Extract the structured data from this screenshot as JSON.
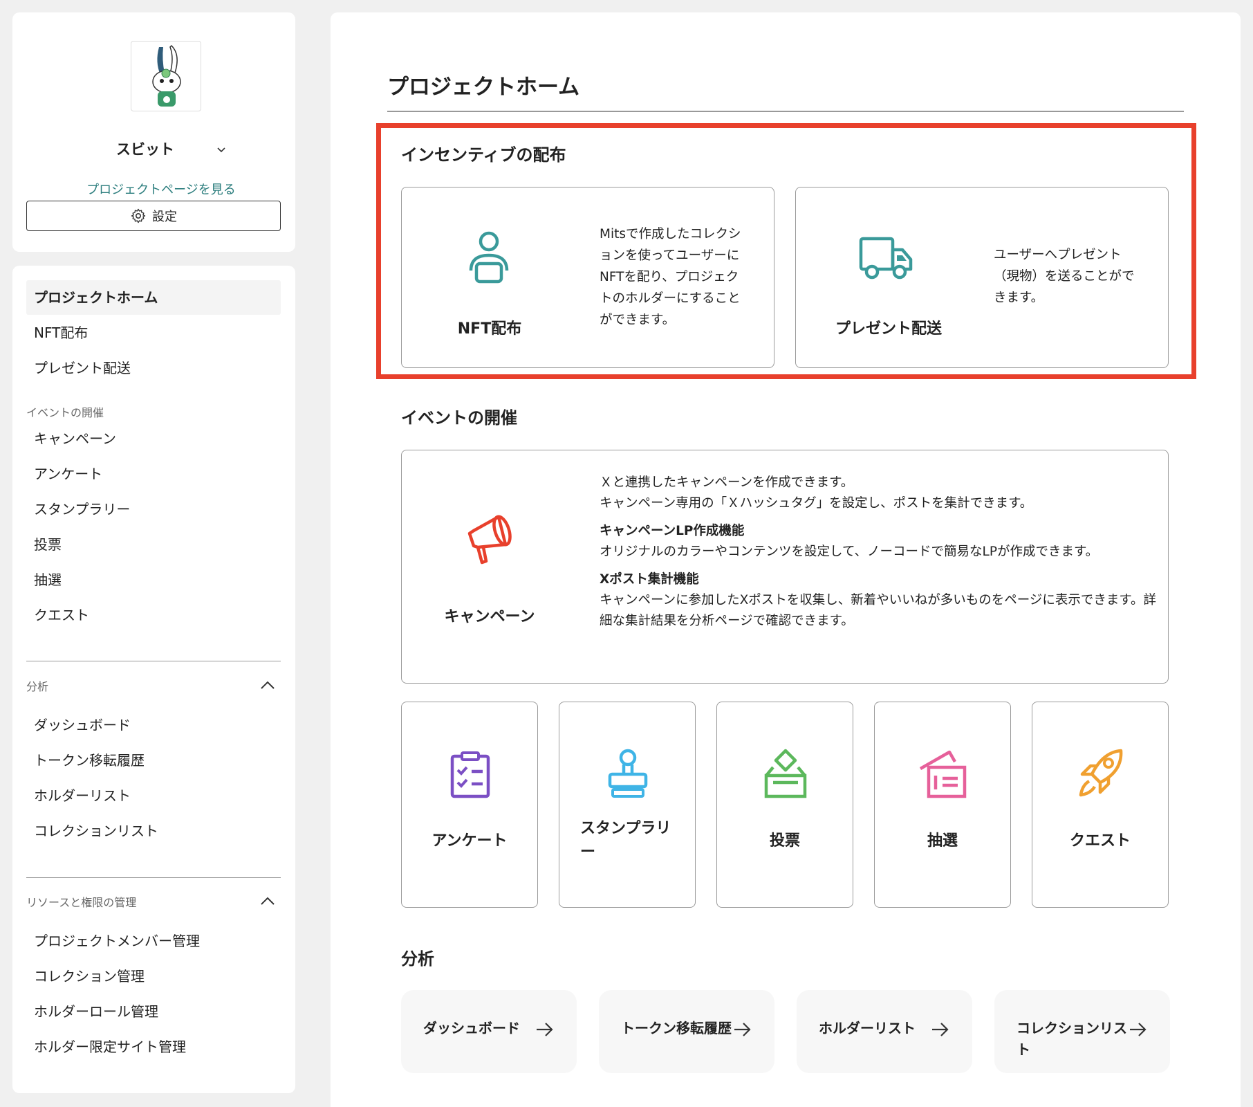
{
  "sidebar": {
    "project_name": "スビット",
    "project_link": "プロジェクトページを見る",
    "settings_label": "設定",
    "top_items": [
      {
        "label": "プロジェクトホーム",
        "active": true
      },
      {
        "label": "NFT配布"
      },
      {
        "label": "プレゼント配送"
      }
    ],
    "events_section": "イベントの開催",
    "event_items": [
      "キャンペーン",
      "アンケート",
      "スタンプラリー",
      "投票",
      "抽選",
      "クエスト"
    ],
    "analytics_section": "分析",
    "analytics_items": [
      "ダッシュボード",
      "トークン移転履歴",
      "ホルダーリスト",
      "コレクションリスト"
    ],
    "resources_section": "リソースと権限の管理",
    "resource_items": [
      "プロジェクトメンバー管理",
      "コレクション管理",
      "ホルダーロール管理",
      "ホルダー限定サイト管理"
    ]
  },
  "main": {
    "page_title": "プロジェクトホーム",
    "incentive": {
      "title": "インセンティブの配布",
      "nft": {
        "label": "NFT配布",
        "desc": "Mitsで作成したコレクションを使ってユーザーにNFTを配り、プロジェクトのホルダーにすることができます。"
      },
      "present": {
        "label": "プレゼント配送",
        "desc": "ユーザーへプレゼント（現物）を送ることができます。"
      }
    },
    "events": {
      "title": "イベントの開催",
      "campaign": {
        "label": "キャンペーン",
        "line1": "Ｘと連携したキャンペーンを作成できます。",
        "line2": "キャンペーン専用の「Ｘハッシュタグ」を設定し、ポストを集計できます。",
        "lp_head": "キャンペーンLP作成機能",
        "lp_desc": "オリジナルのカラーやコンテンツを設定して、ノーコードで簡易なLPが作成できます。",
        "agg_head": "Xポスト集計機能",
        "agg_desc": "キャンペーンに参加したXポストを収集し、新着やいいねが多いものをページに表示できます。詳細な集計結果を分析ページで確認できます。"
      },
      "cards": [
        "アンケート",
        "スタンプラリー",
        "投票",
        "抽選",
        "クエスト"
      ]
    },
    "analytics": {
      "title": "分析",
      "buttons": [
        "ダッシュボード",
        "トークン移転履歴",
        "ホルダーリスト",
        "コレクションリスト"
      ]
    }
  },
  "colors": {
    "highlight": "#e8402c",
    "teal": "#3a9a9a",
    "campaign": "#e8402c",
    "survey": "#7b4fc4",
    "stamp": "#3fb4e6",
    "vote": "#5cb85c",
    "lottery": "#e6609a",
    "quest": "#f0a030"
  }
}
